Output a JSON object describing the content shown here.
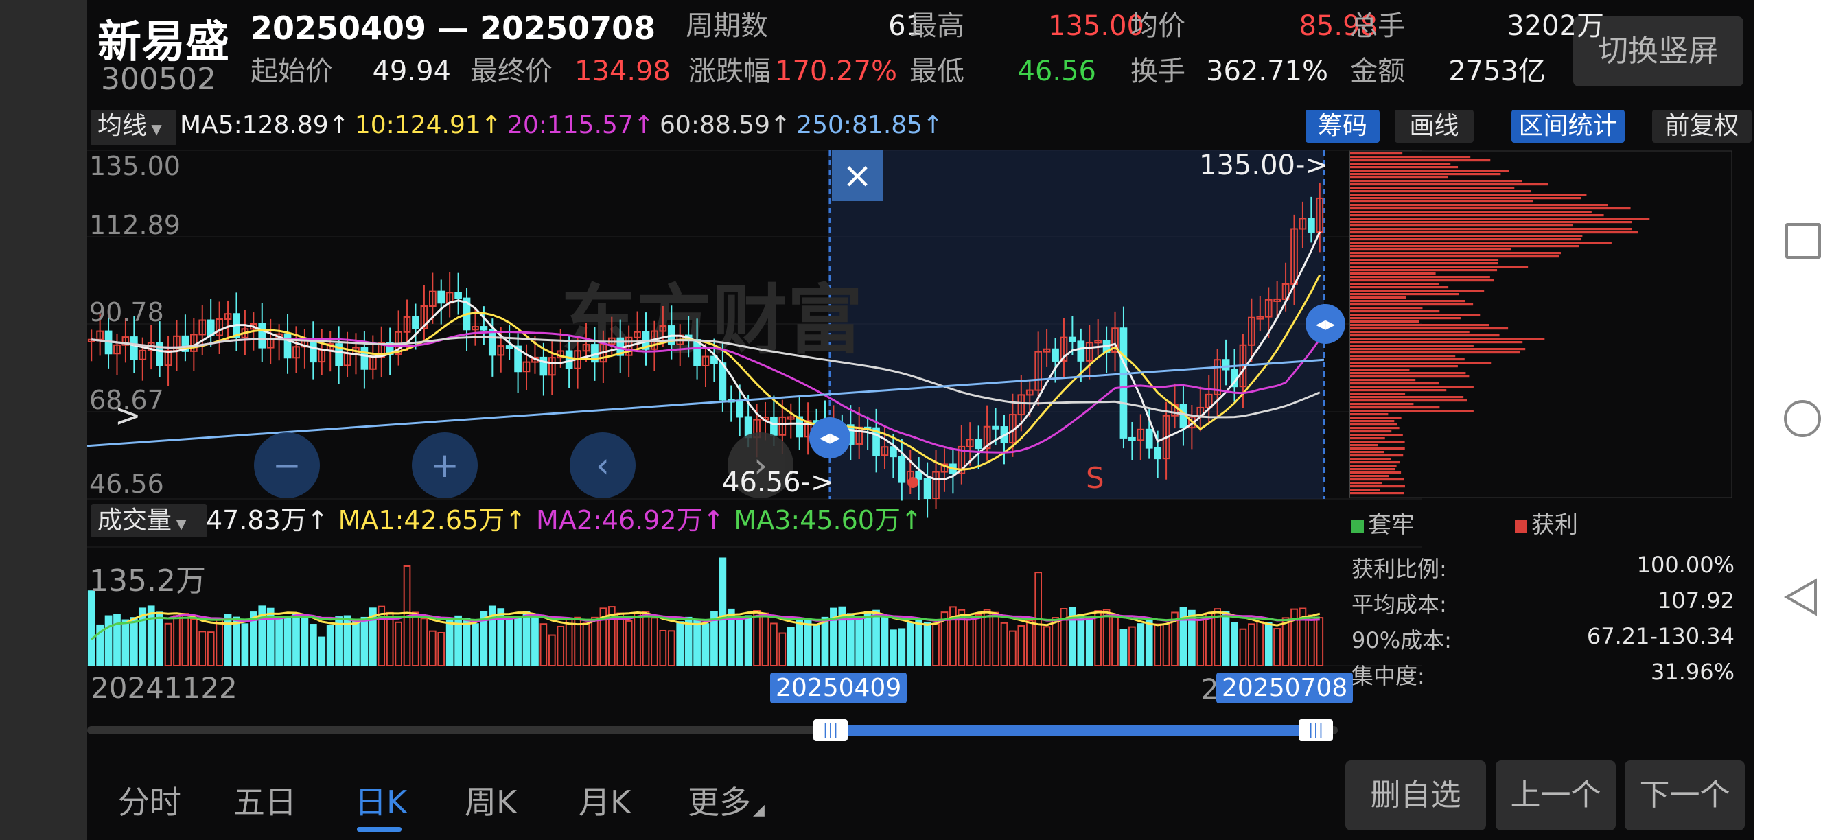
{
  "stock": {
    "name": "新易盛",
    "code": "300502",
    "range": "20250409 — 20250708",
    "switch_btn": "切换竖屏"
  },
  "stats_row1": [
    {
      "label": "周期数",
      "value": "61",
      "color": "white"
    },
    {
      "label": "最高",
      "value": "135.00",
      "color": "red"
    },
    {
      "label": "均价",
      "value": "85.98",
      "color": "red"
    },
    {
      "label": "总手",
      "value": "3202万",
      "color": "white"
    }
  ],
  "stats_row2": [
    {
      "label": "起始价",
      "value": "49.94",
      "color": "white"
    },
    {
      "label": "最终价",
      "value": "134.98",
      "color": "red"
    },
    {
      "label": "涨跌幅",
      "value": "170.27%",
      "color": "red"
    },
    {
      "label": "最低",
      "value": "46.56",
      "color": "green"
    },
    {
      "label": "换手",
      "value": "362.71%",
      "color": "white"
    },
    {
      "label": "金额",
      "value": "2753亿",
      "color": "white"
    }
  ],
  "ma_bar": {
    "selector": "均线",
    "items": [
      {
        "text": "MA5:128.89↑",
        "color": "#f0f0f0"
      },
      {
        "text": "10:124.91↑",
        "color": "#ffe34d"
      },
      {
        "text": "20:115.57↑",
        "color": "#d63fd6"
      },
      {
        "text": "60:88.59↑",
        "color": "#d8d8d8"
      },
      {
        "text": "250:81.85↑",
        "color": "#7fb8f5"
      }
    ],
    "buttons": [
      {
        "label": "筹码",
        "active": true
      },
      {
        "label": "画线",
        "active": false
      },
      {
        "label": "区间统计",
        "active": true
      },
      {
        "label": "前复权",
        "active": false
      }
    ]
  },
  "price_axis": [
    "135.00",
    "112.89",
    "90.78",
    "68.67",
    "46.56"
  ],
  "markers": {
    "high": "135.00->",
    "low": "46.56->",
    "signal": "S",
    "close": "×"
  },
  "volume_bar": {
    "selector": "成交量",
    "items": [
      {
        "text": "47.83万↑",
        "color": "#f0f0f0"
      },
      {
        "text": "MA1:42.65万↑",
        "color": "#ffe34d"
      },
      {
        "text": "MA2:46.92万↑",
        "color": "#d63fd6"
      },
      {
        "text": "MA3:45.60万↑",
        "color": "#4fd14f"
      }
    ],
    "max_label": "135.2万"
  },
  "timeline": {
    "start": "20241122",
    "sel_start": "20250409",
    "sel_end": "20250708",
    "partial": "2"
  },
  "chip": {
    "legend": [
      {
        "label": "套牢",
        "color": "#3ab54a"
      },
      {
        "label": "获利",
        "color": "#d9403a"
      }
    ],
    "rows": [
      {
        "label": "获利比例:",
        "value": "100.00%"
      },
      {
        "label": "平均成本:",
        "value": "107.92"
      },
      {
        "label": "90%成本:",
        "value": "67.21-130.34"
      },
      {
        "label": "集中度:",
        "value": "31.96%"
      }
    ]
  },
  "tabs": [
    {
      "label": "分时",
      "active": false
    },
    {
      "label": "五日",
      "active": false
    },
    {
      "label": "日K",
      "active": true
    },
    {
      "label": "周K",
      "active": false
    },
    {
      "label": "月K",
      "active": false
    },
    {
      "label": "更多",
      "active": false
    }
  ],
  "actions": [
    "删自选",
    "上一个",
    "下一个"
  ],
  "watermark": "东方财富",
  "colors": {
    "up": "#e0453c",
    "down": "#5ff0f0",
    "selection": "#3a78d8"
  }
}
